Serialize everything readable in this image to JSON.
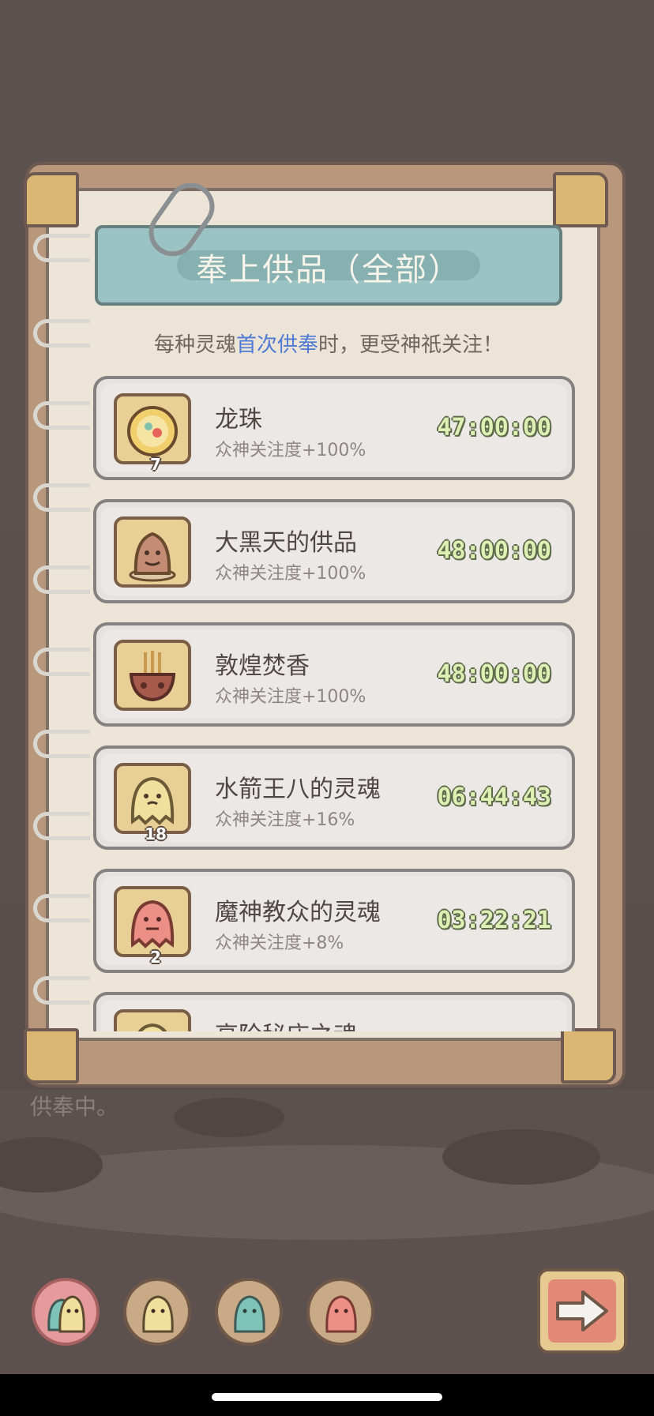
{
  "title": "奉上供品（全部）",
  "subtitle": {
    "before": "每种灵魂",
    "highlight": "首次供奉",
    "after": "时，更受神祇关注！"
  },
  "items": [
    {
      "name": "龙珠",
      "effect": "众神关注度+100%",
      "timer": "47:00:00",
      "count": "7",
      "icon": "dragon-orb-icon"
    },
    {
      "name": "大黑天的供品",
      "effect": "众神关注度+100%",
      "timer": "48:00:00",
      "count": "",
      "icon": "mahakala-offering-icon"
    },
    {
      "name": "敦煌焚香",
      "effect": "众神关注度+100%",
      "timer": "48:00:00",
      "count": "",
      "icon": "incense-burner-icon"
    },
    {
      "name": "水箭王八的灵魂",
      "effect": "众神关注度+16%",
      "timer": "06:44:43",
      "count": "18",
      "icon": "yellow-ghost-icon"
    },
    {
      "name": "魔神教众的灵魂",
      "effect": "众神关注度+8%",
      "timer": "03:22:21",
      "count": "2",
      "icon": "red-ghost-icon"
    },
    {
      "name": "高阶秘庄之魂",
      "effect": "",
      "timer": "",
      "count": "",
      "icon": "ghost-icon"
    }
  ],
  "status": "供奉中。",
  "colors": {
    "highlight": "#4e7ad6",
    "timer": "#dff0b5",
    "banner": "#9cc3c3"
  }
}
